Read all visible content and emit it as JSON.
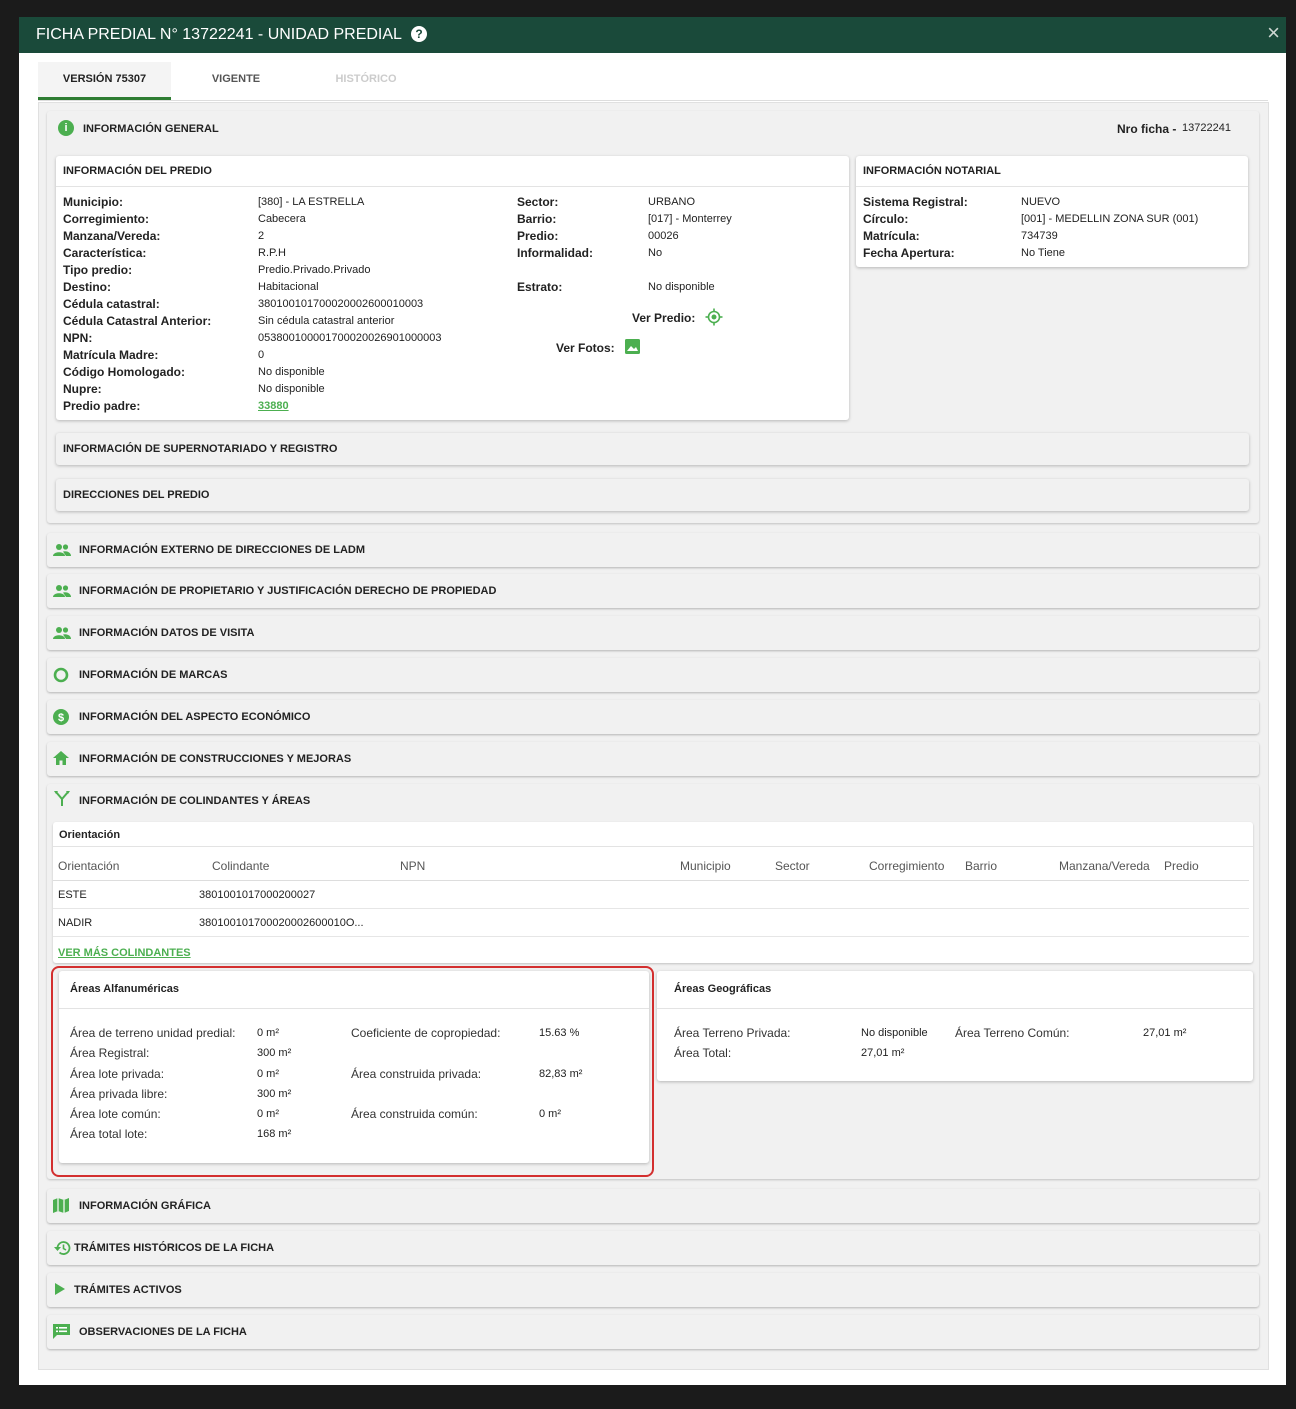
{
  "header": {
    "title": "FICHA PREDIAL N° 13722241 - UNIDAD PREDIAL",
    "help": "?",
    "close": "×"
  },
  "tabs": [
    "VERSIÓN 75307",
    "VIGENTE",
    "HISTÓRICO"
  ],
  "general": {
    "title": "INFORMACIÓN GENERAL",
    "nro_label": "Nro ficha -",
    "nro_value": "13722241"
  },
  "predio": {
    "title": "INFORMACIÓN DEL PREDIO",
    "left": [
      [
        "Municipio:",
        "[380] - LA ESTRELLA"
      ],
      [
        "Corregimiento:",
        "Cabecera"
      ],
      [
        "Manzana/Vereda:",
        "2"
      ],
      [
        "Característica:",
        "R.P.H"
      ],
      [
        "Tipo predio:",
        "Predio.Privado.Privado"
      ],
      [
        "Destino:",
        "Habitacional"
      ],
      [
        "Cédula catastral:",
        "380100101700020002600010003"
      ],
      [
        "Cédula Catastral Anterior:",
        "Sin cédula catastral anterior"
      ],
      [
        "NPN:",
        "053800100001700020026901000003"
      ],
      [
        "Matrícula Madre:",
        "0"
      ],
      [
        "Código Homologado:",
        "No disponible"
      ],
      [
        "Nupre:",
        "No disponible"
      ],
      [
        "Predio padre:",
        "33880"
      ]
    ],
    "right": [
      [
        "Sector:",
        "URBANO"
      ],
      [
        "Barrio:",
        "[017] - Monterrey"
      ],
      [
        "Predio:",
        "00026"
      ],
      [
        "Informalidad:",
        "No"
      ],
      [
        "Estrato:",
        "No disponible"
      ]
    ],
    "ver_predio": "Ver Predio:",
    "ver_fotos": "Ver Fotos:"
  },
  "notarial": {
    "title": "INFORMACIÓN NOTARIAL",
    "rows": [
      [
        "Sistema Registral:",
        "NUEVO"
      ],
      [
        "Círculo:",
        "[001] - MEDELLIN ZONA SUR (001)"
      ],
      [
        "Matrícula:",
        "734739"
      ],
      [
        "Fecha Apertura:",
        "No Tiene"
      ]
    ]
  },
  "sub_sections": [
    "INFORMACIÓN DE SUPERNOTARIADO Y REGISTRO",
    "DIRECCIONES DEL PREDIO"
  ],
  "sections": [
    {
      "label": "INFORMACIÓN EXTERNO DE DIRECCIONES DE LADM",
      "icon": "people-icon"
    },
    {
      "label": "INFORMACIÓN DE PROPIETARIO Y JUSTIFICACIÓN DERECHO DE PROPIEDAD",
      "icon": "people-icon"
    },
    {
      "label": "INFORMACIÓN DATOS DE VISITA",
      "icon": "people-icon"
    },
    {
      "label": "INFORMACIÓN DE MARCAS",
      "icon": "circle-icon"
    },
    {
      "label": "INFORMACIÓN DEL ASPECTO ECONÓMICO",
      "icon": "dollar-icon"
    },
    {
      "label": "INFORMACIÓN DE CONSTRUCCIONES Y MEJORAS",
      "icon": "home-icon"
    },
    {
      "label": "INFORMACIÓN DE COLINDANTES Y ÁREAS",
      "icon": "fork-icon"
    }
  ],
  "colindantes": {
    "title": "Orientación",
    "headers": [
      "Orientación",
      "Colindante",
      "NPN",
      "Municipio",
      "Sector",
      "Corregimiento",
      "Barrio",
      "Manzana/Vereda",
      "Predio"
    ],
    "rows": [
      [
        "ESTE",
        "3801001017000200027"
      ],
      [
        "NADIR",
        "380100101700020002600010O..."
      ]
    ],
    "more": "VER MÁS COLINDANTES"
  },
  "alfa": {
    "title": "Áreas Alfanuméricas",
    "left": [
      [
        "Área de terreno unidad predial:",
        "0 m²"
      ],
      [
        "Área Registral:",
        "300 m²"
      ],
      [
        "Área lote privada:",
        "0 m²"
      ],
      [
        "Área privada libre:",
        "300 m²"
      ],
      [
        "Área lote común:",
        "0 m²"
      ],
      [
        "Área total lote:",
        "168 m²"
      ]
    ],
    "right": [
      [
        "Coeficiente de copropiedad:",
        "15.63 %"
      ],
      [
        "Área construida privada:",
        "82,83 m²"
      ],
      [
        "Área construida común:",
        "0 m²"
      ]
    ]
  },
  "geo": {
    "title": "Áreas Geográficas",
    "rows": [
      [
        "Área Terreno Privada:",
        "No disponible"
      ],
      [
        "Área Total:",
        "27,01 m²"
      ]
    ],
    "comun_label": "Área Terreno Común:",
    "comun_value": "27,01 m²"
  },
  "bottom_sections": [
    {
      "label": "INFORMACIÓN GRÁFICA",
      "icon": "map-icon"
    },
    {
      "label": "TRÁMITES HISTÓRICOS DE LA FICHA",
      "icon": "history-icon"
    },
    {
      "label": "TRÁMITES ACTIVOS",
      "icon": "play-icon"
    },
    {
      "label": "OBSERVACIONES DE LA FICHA",
      "icon": "comment-icon"
    }
  ],
  "colors": {
    "header": "#1a4a3a",
    "accent": "#4caf50",
    "highlight": "#d32f2f"
  }
}
